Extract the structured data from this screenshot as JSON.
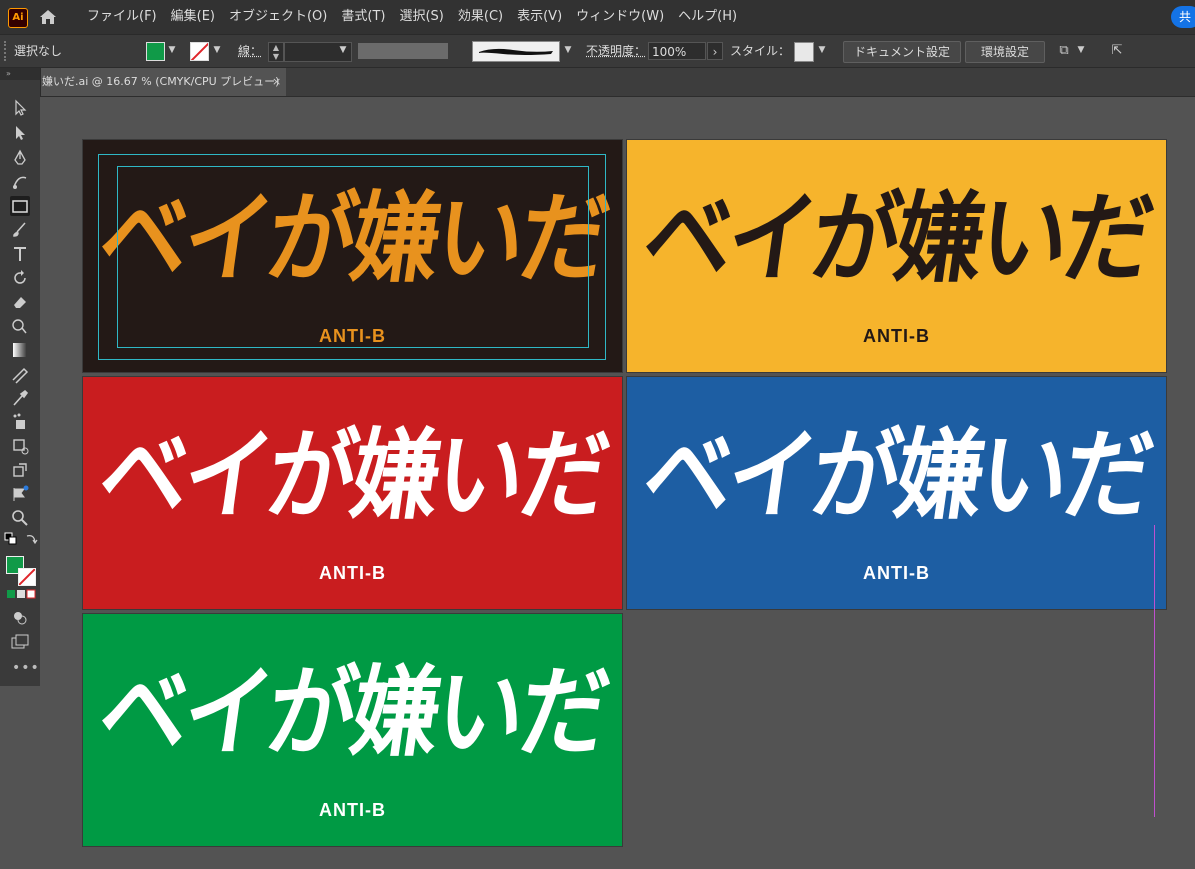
{
  "app": {
    "logo_text": "Ai"
  },
  "menu": [
    "ファイル(F)",
    "編集(E)",
    "オブジェクト(O)",
    "書式(T)",
    "選択(S)",
    "効果(C)",
    "表示(V)",
    "ウィンドウ(W)",
    "ヘルプ(H)"
  ],
  "share_label": "共",
  "control_bar": {
    "selection": "選択なし",
    "stroke_label": "線：",
    "opacity_label": "不透明度：",
    "opacity_value": "100%",
    "style_label": "スタイル：",
    "document_setup": "ドキュメント設定",
    "preferences": "環境設定",
    "fill_color": "#109a48"
  },
  "doc_tab": {
    "title": "嫌いだ.ai @ 16.67 % (CMYK/CPU プレビュー)",
    "close": "×"
  },
  "artboards": [
    {
      "title": "ベイが嫌いだ",
      "subtitle": "ANTI-B",
      "bg": "#231916",
      "fg": "#e8921e"
    },
    {
      "title": "ベイが嫌いだ",
      "subtitle": "ANTI-B",
      "bg": "#f6b42c",
      "fg": "#231916"
    },
    {
      "title": "ベイが嫌いだ",
      "subtitle": "ANTI-B",
      "bg": "#c91d1f",
      "fg": "#ffffff"
    },
    {
      "title": "ベイが嫌いだ",
      "subtitle": "ANTI-B",
      "bg": "#1d5ea3",
      "fg": "#ffffff"
    },
    {
      "title": "ベイが嫌いだ",
      "subtitle": "ANTI-B",
      "bg": "#009a44",
      "fg": "#ffffff"
    }
  ],
  "tools": [
    "selection-tool-icon",
    "direct-selection-tool-icon",
    "pen-tool-icon",
    "curvature-tool-icon",
    "rectangle-tool-icon",
    "paintbrush-tool-icon",
    "type-tool-icon",
    "rotate-tool-icon",
    "eraser-tool-icon",
    "shape-builder-tool-icon",
    "gradient-tool-icon",
    "blend-tool-icon",
    "eyedropper-tool-icon",
    "symbol-sprayer-tool-icon",
    "artboard-tool-icon",
    "scale-tool-icon",
    "puppet-warp-tool-icon",
    "zoom-tool-icon"
  ]
}
